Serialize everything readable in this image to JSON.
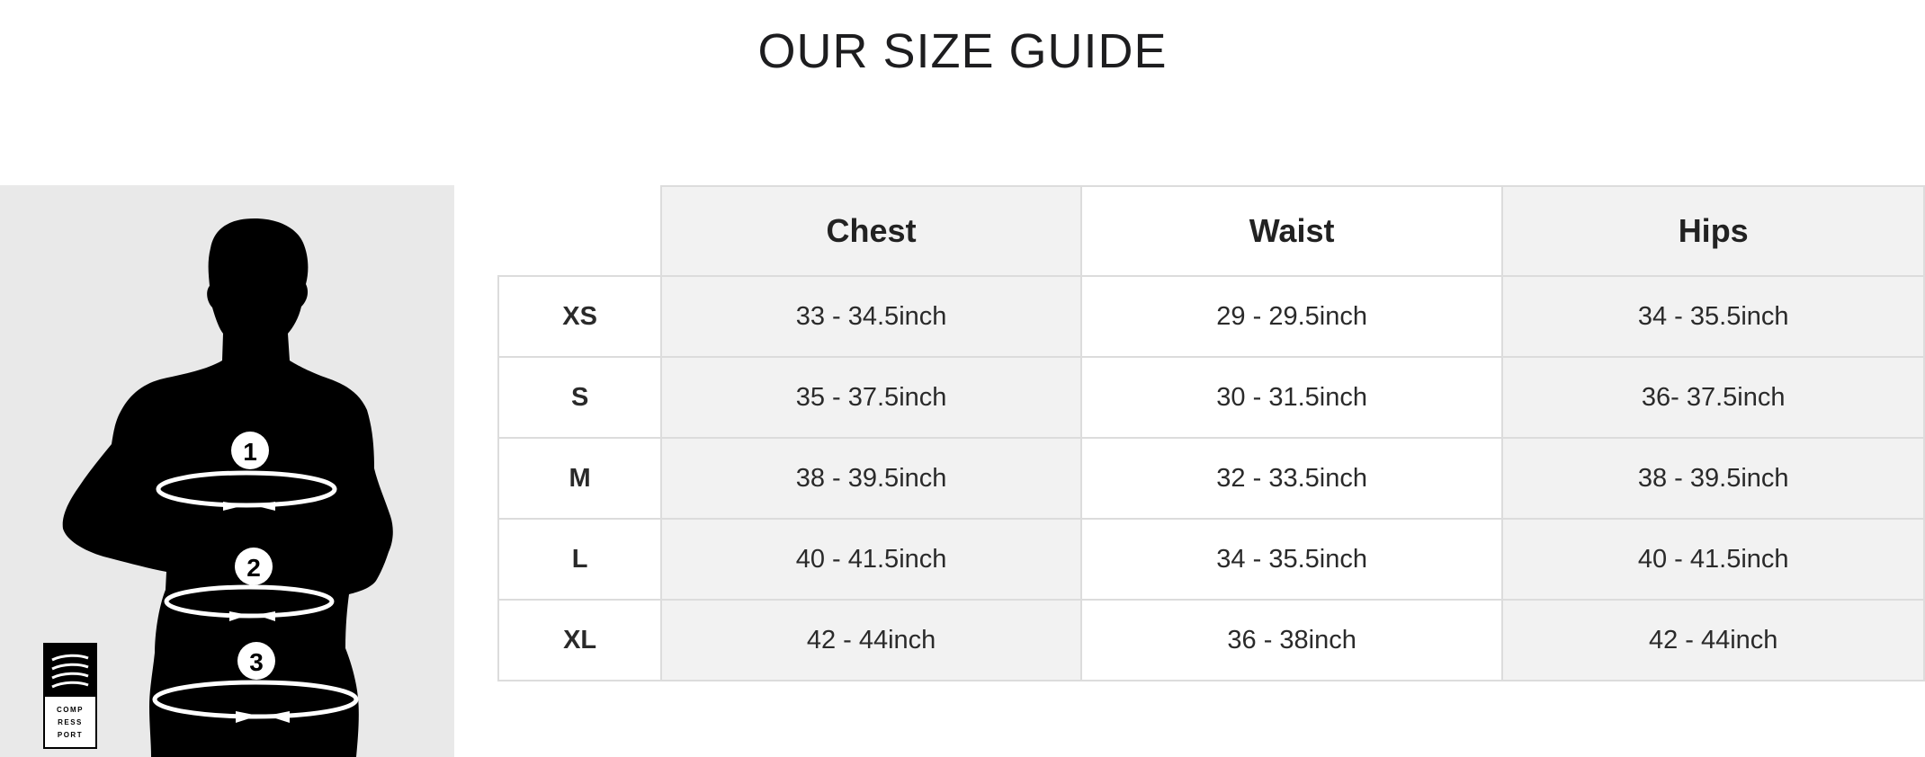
{
  "title": "OUR SIZE GUIDE",
  "illustration": {
    "markers": [
      "1",
      "2",
      "3"
    ],
    "logo_text": [
      "COMP",
      "RESS",
      "PORT"
    ]
  },
  "table": {
    "columns": [
      "Chest",
      "Waist",
      "Hips"
    ],
    "rows": [
      {
        "size": "XS",
        "values": [
          "33 - 34.5inch",
          "29 - 29.5inch",
          "34 - 35.5inch"
        ]
      },
      {
        "size": "S",
        "values": [
          "35 - 37.5inch",
          "30 - 31.5inch",
          "36- 37.5inch"
        ]
      },
      {
        "size": "M",
        "values": [
          "38 - 39.5inch",
          "32 - 33.5inch",
          "38 - 39.5inch"
        ]
      },
      {
        "size": "L",
        "values": [
          "40 - 41.5inch",
          "34 - 35.5inch",
          "40 - 41.5inch"
        ]
      },
      {
        "size": "XL",
        "values": [
          "42 - 44inch",
          "36 - 38inch",
          "42 - 44inch"
        ]
      }
    ]
  }
}
